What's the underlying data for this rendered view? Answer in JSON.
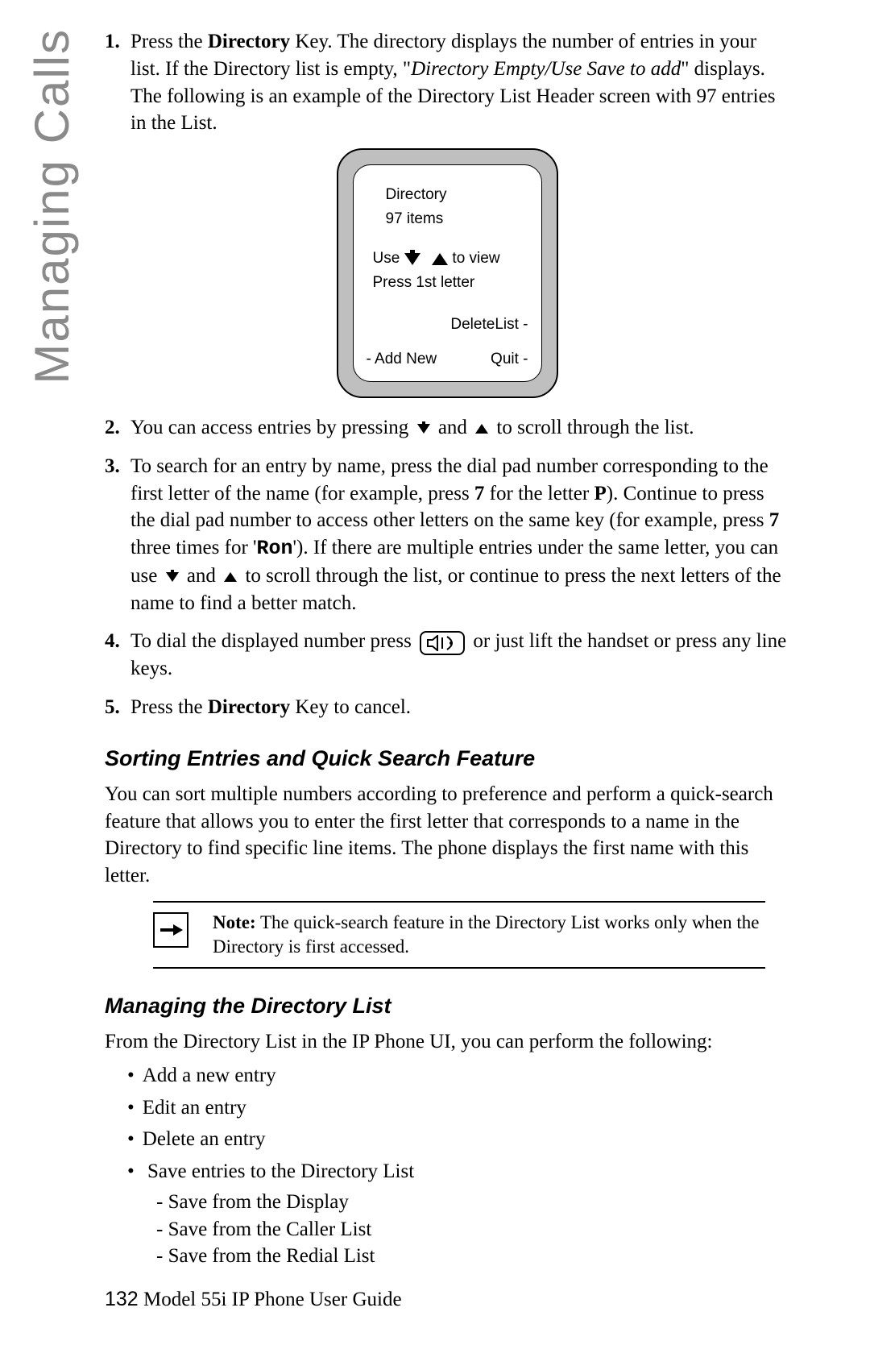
{
  "side_tab": "Managing Calls",
  "steps": {
    "s1": {
      "num": "1.",
      "t1": "Press the ",
      "t2": "Directory",
      "t3": " Key. The directory displays the number of entries in your list. If the Directory list is empty, \"",
      "t4": "Directory Empty/Use Save to add",
      "t5": "\" displays. The following is an example of the Directory List Header screen with 97 entries in the List."
    },
    "s2": {
      "num": "2.",
      "t1": "You can access entries by pressing ",
      "t2": " and ",
      "t3": " to scroll through the list."
    },
    "s3": {
      "num": "3.",
      "t1": "To search for an entry by name, press the dial pad number corresponding to the first letter of the name (for example, press ",
      "t2": "7",
      "t3": " for the letter ",
      "t4": "P",
      "t5": "). Continue to press the dial pad number to access other letters on the same key (for example, press ",
      "t6": "7",
      "t7": " three times for '",
      "t8": "Ron",
      "t9": "'). If there are multiple entries under the same letter, you can use ",
      "t10": " and ",
      "t11": " to scroll through the list, or continue to press the next letters of the name to find a better match."
    },
    "s4": {
      "num": "4.",
      "t1": "To dial the displayed number press ",
      "t2": " or just lift the handset or press any line keys."
    },
    "s5": {
      "num": "5.",
      "t1": "Press the ",
      "t2": "Directory",
      "t3": " Key to cancel."
    }
  },
  "phone": {
    "title": "Directory",
    "count": "97 items",
    "use_pre": "Use ",
    "use_post": " to view",
    "press": "Press 1st letter",
    "delete": "DeleteList -",
    "add": "- Add New",
    "quit": "Quit -"
  },
  "section1": {
    "title": "Sorting Entries and Quick Search Feature",
    "para": "You can sort multiple numbers according to preference and perform a quick-search feature that allows you to enter the first letter that corresponds to a name in the Directory to find specific line items. The phone displays the first name with this letter."
  },
  "note": {
    "label": "Note:",
    "text": " The quick-search feature in the Directory List works only when the Directory is first accessed."
  },
  "section2": {
    "title": "Managing the Directory List",
    "para": "From the Directory List in the IP Phone UI, you can perform the following:",
    "bullets": {
      "b1": "Add a new entry",
      "b2": "Edit an entry",
      "b3": "Delete an entry",
      "b4": "Save entries to the Directory List",
      "s1": "Save from the Display",
      "s2": "Save from the Caller List",
      "s3": "Save from the Redial List"
    }
  },
  "footer": {
    "page": "132",
    "title": " Model 55i IP Phone User Guide"
  }
}
